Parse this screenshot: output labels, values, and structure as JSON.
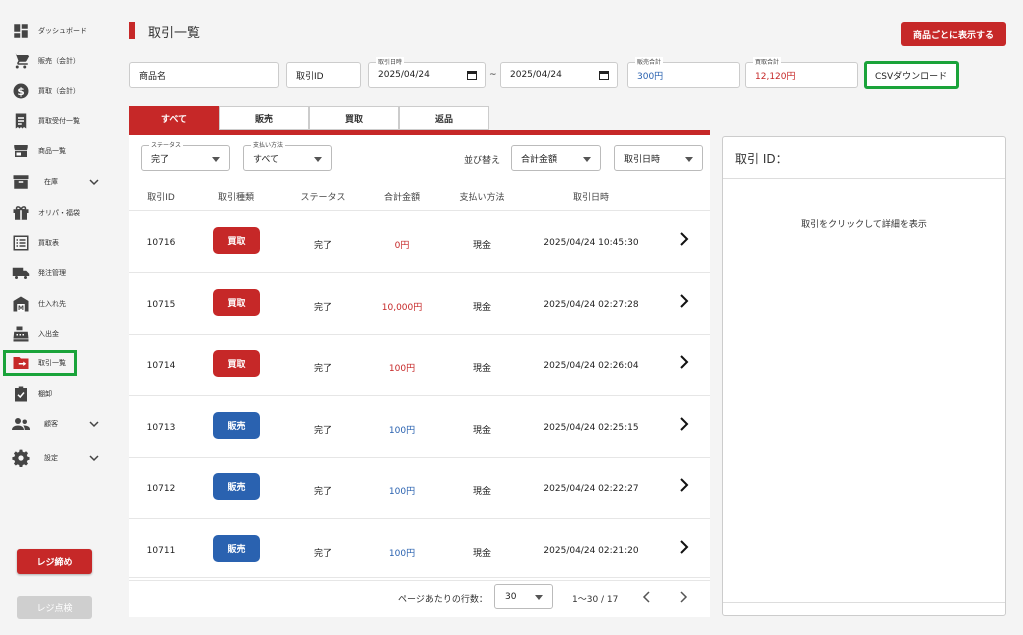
{
  "sidebar": {
    "items": [
      {
        "label": "ダッシュボード",
        "icon": "dashboard-icon"
      },
      {
        "label": "販売（会計）",
        "icon": "cart-icon"
      },
      {
        "label": "買取（会計）",
        "icon": "dollar-icon"
      },
      {
        "label": "買取受付一覧",
        "icon": "receipt-icon"
      },
      {
        "label": "商品一覧",
        "icon": "store-icon"
      },
      {
        "label": "在庫",
        "icon": "inventory-icon"
      },
      {
        "label": "オリパ・福袋",
        "icon": "gift-icon"
      },
      {
        "label": "買取表",
        "icon": "list-icon"
      },
      {
        "label": "発注管理",
        "icon": "truck-icon"
      },
      {
        "label": "仕入れ先",
        "icon": "warehouse-icon"
      },
      {
        "label": "入出金",
        "icon": "register-icon"
      },
      {
        "label": "取引一覧",
        "icon": "folder-icon"
      },
      {
        "label": "棚卸",
        "icon": "clipboard-check-icon"
      },
      {
        "label": "顧客",
        "icon": "people-icon"
      },
      {
        "label": "設定",
        "icon": "gear-icon"
      }
    ],
    "close_register_label": "レジ締め",
    "check_register_label": "レジ点検"
  },
  "header": {
    "title": "取引一覧",
    "by_product_label": "商品ごとに表示する"
  },
  "filters": {
    "product_name_placeholder": "商品名",
    "transaction_id_placeholder": "取引ID",
    "date_label": "取引日時",
    "date_from": "2025/04/24",
    "date_to": "2025/04/24",
    "date_separator": "~",
    "sales_total_label": "販売合計",
    "sales_total_value": "300円",
    "purchase_total_label": "買取合計",
    "purchase_total_value": "12,120円",
    "csv_label": "CSVダウンロード"
  },
  "tabs": [
    {
      "label": "すべて"
    },
    {
      "label": "販売"
    },
    {
      "label": "買取"
    },
    {
      "label": "返品"
    }
  ],
  "list_controls": {
    "status_label": "ステータス",
    "status_value": "完了",
    "payment_label": "支払い方法",
    "payment_value": "すべて",
    "sort_label": "並び替え",
    "sort_field": "合計金額",
    "sort_field2": "取引日時"
  },
  "table": {
    "columns": [
      "取引ID",
      "取引種類",
      "ステータス",
      "合計金額",
      "支払い方法",
      "取引日時"
    ],
    "rows": [
      {
        "id": "10716",
        "type": "買取",
        "kind": "buy",
        "status": "完了",
        "amount": "0円",
        "payment": "現金",
        "datetime": "2025/04/24 10:45:30"
      },
      {
        "id": "10715",
        "type": "買取",
        "kind": "buy",
        "status": "完了",
        "amount": "10,000円",
        "payment": "現金",
        "datetime": "2025/04/24 02:27:28"
      },
      {
        "id": "10714",
        "type": "買取",
        "kind": "buy",
        "status": "完了",
        "amount": "100円",
        "payment": "現金",
        "datetime": "2025/04/24 02:26:04"
      },
      {
        "id": "10713",
        "type": "販売",
        "kind": "sell",
        "status": "完了",
        "amount": "100円",
        "payment": "現金",
        "datetime": "2025/04/24 02:25:15"
      },
      {
        "id": "10712",
        "type": "販売",
        "kind": "sell",
        "status": "完了",
        "amount": "100円",
        "payment": "現金",
        "datetime": "2025/04/24 02:22:27"
      },
      {
        "id": "10711",
        "type": "販売",
        "kind": "sell",
        "status": "完了",
        "amount": "100円",
        "payment": "現金",
        "datetime": "2025/04/24 02:21:20"
      }
    ]
  },
  "pagination": {
    "rows_per_page_label": "ページあたりの行数：",
    "rows_per_page": "30",
    "range": "1〜30 / 17"
  },
  "detail": {
    "title": "取引 ID：",
    "hint": "取引をクリックして詳細を表示"
  },
  "colors": {
    "accent": "#c62828",
    "sell_blue": "#2a62b0",
    "highlight_green": "#1aa33a"
  }
}
